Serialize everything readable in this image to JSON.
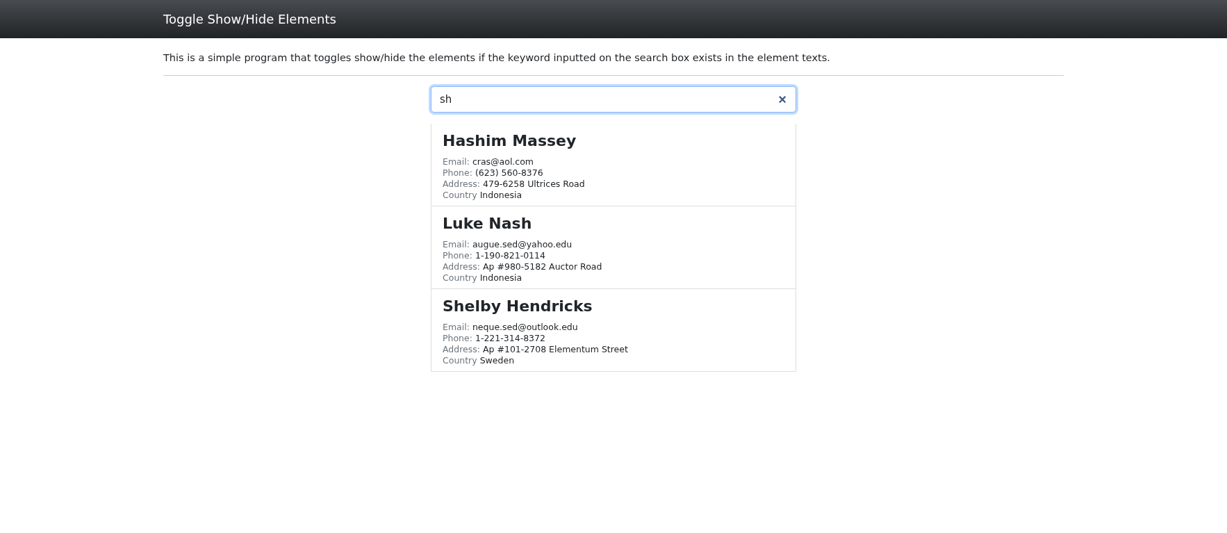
{
  "navbar": {
    "title": "Toggle Show/Hide Elements"
  },
  "description": "This is a simple program that toggles show/hide the elements if the keyword inputted on the search box exists in the element texts.",
  "search": {
    "value": "sh",
    "clear": "×"
  },
  "contacts": [
    {
      "name": "Hashim Massey",
      "fields": [
        {
          "label": "Email:",
          "value": "cras@aol.com"
        },
        {
          "label": "Phone:",
          "value": "(623) 560-8376"
        },
        {
          "label": "Address:",
          "value": "479-6258 Ultrices Road"
        },
        {
          "label": "Country",
          "value": "Indonesia"
        }
      ]
    },
    {
      "name": "Luke Nash",
      "fields": [
        {
          "label": "Email:",
          "value": "augue.sed@yahoo.edu"
        },
        {
          "label": "Phone:",
          "value": "1-190-821-0114"
        },
        {
          "label": "Address:",
          "value": "Ap #980-5182 Auctor Road"
        },
        {
          "label": "Country",
          "value": "Indonesia"
        }
      ]
    },
    {
      "name": "Shelby Hendricks",
      "fields": [
        {
          "label": "Email:",
          "value": "neque.sed@outlook.edu"
        },
        {
          "label": "Phone:",
          "value": "1-221-314-8372"
        },
        {
          "label": "Address:",
          "value": "Ap #101-2708 Elementum Street"
        },
        {
          "label": "Country",
          "value": "Sweden"
        }
      ]
    }
  ]
}
